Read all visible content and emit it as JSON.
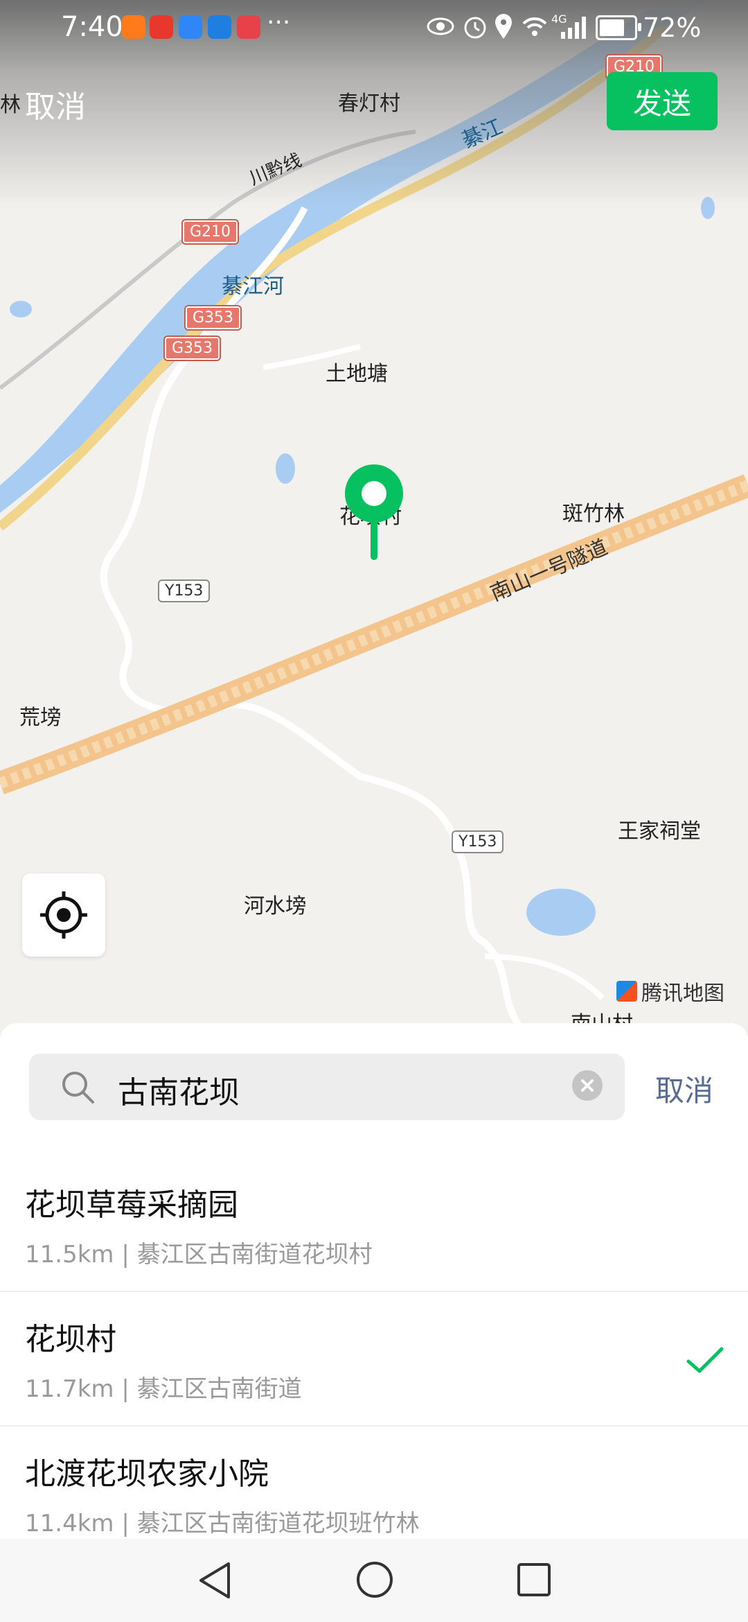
{
  "status_bar": {
    "time": "7:40",
    "battery_percent": "72%",
    "battery_level": 0.72,
    "more": "···",
    "network": "4G"
  },
  "topbar": {
    "cancel_label": "取消",
    "send_label": "发送"
  },
  "map": {
    "labels": {
      "chundeng": "春灯村",
      "linpartial": "林",
      "qijiang": "綦江",
      "chuanqian": "川黔线",
      "qijianghe": "綦江河",
      "tudi": "土地塘",
      "huaba": "花坝村",
      "banzhu": "斑竹林",
      "huang": "荒塝",
      "tunnel": "南山一号隧道",
      "wangjia": "王家祠堂",
      "heshui": "河水塝",
      "nanshan": "南山村"
    },
    "shields": {
      "g210_top": "G210",
      "g210": "G210",
      "g353a": "G353",
      "g353b": "G353",
      "y153a": "Y153",
      "y153b": "Y153"
    },
    "attribution": "腾讯地图",
    "accent_color": "#07c160"
  },
  "search": {
    "query": "古南花坝",
    "cancel_label": "取消"
  },
  "results": [
    {
      "name": "花坝草莓采摘园",
      "detail": "11.5km | 綦江区古南街道花坝村",
      "selected": false
    },
    {
      "name": "花坝村",
      "detail": "11.7km | 綦江区古南街道",
      "selected": true
    },
    {
      "name": "北渡花坝农家小院",
      "detail": "11.4km | 綦江区古南街道花坝班竹林",
      "selected": false
    }
  ]
}
